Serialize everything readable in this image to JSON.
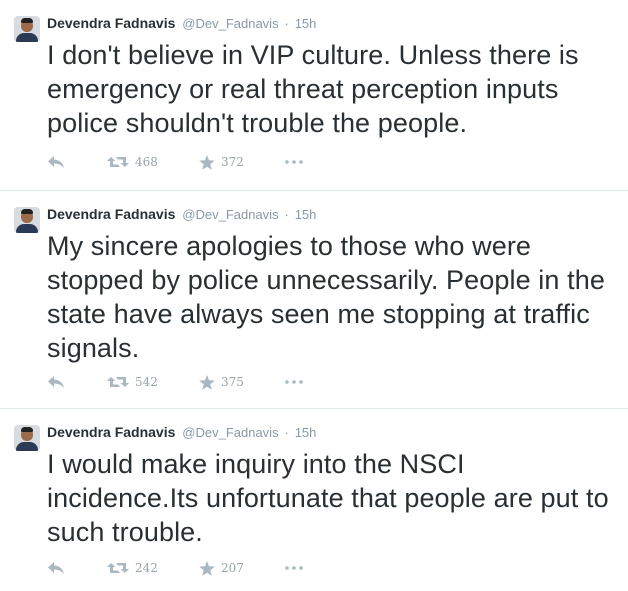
{
  "tweets": [
    {
      "name": "Devendra Fadnavis",
      "handle": "@Dev_Fadnavis",
      "dot": "·",
      "time": "15h",
      "text": "I don't believe in VIP culture. Unless there is emergency or real threat perception inputs police shouldn't trouble the people.",
      "retweets": "468",
      "favorites": "372"
    },
    {
      "name": "Devendra Fadnavis",
      "handle": "@Dev_Fadnavis",
      "dot": "·",
      "time": "15h",
      "text": "My sincere apologies to those who were stopped by police unnecessarily. People in the state have always seen me stopping at traffic signals.",
      "retweets": "542",
      "favorites": "375"
    },
    {
      "name": "Devendra Fadnavis",
      "handle": "@Dev_Fadnavis",
      "dot": "·",
      "time": "15h",
      "text": "I would make inquiry into the NSCI incidence.Its unfortunate that people are put to such trouble.",
      "retweets": "242",
      "favorites": "207"
    }
  ],
  "icons": {
    "reply": "reply-icon",
    "retweet": "retweet-icon",
    "favorite": "star-icon",
    "more": "more-dots-icon"
  },
  "colors": {
    "text": "#292f33",
    "muted": "#8899a6",
    "icon": "#aab8c2",
    "divider": "#e1e8ed"
  }
}
